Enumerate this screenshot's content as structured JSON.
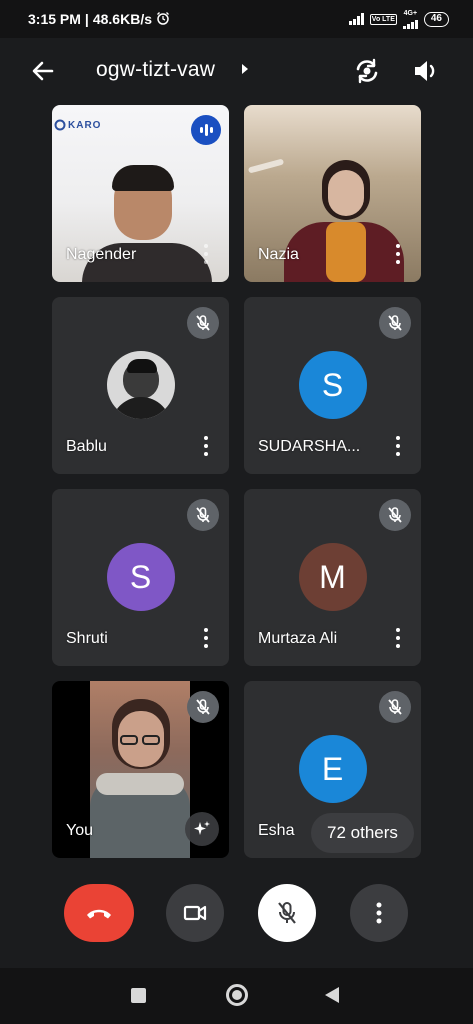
{
  "status_bar": {
    "time": "3:15 PM",
    "speed": "48.6KB/s",
    "network_label": "4G+",
    "volte_label": "Vo LTE",
    "battery": "46"
  },
  "header": {
    "meeting_code": "ogw-tizt-vaw",
    "icons": [
      "back-arrow-icon",
      "caret-right-icon",
      "switch-camera-icon",
      "speaker-icon"
    ]
  },
  "participants": [
    {
      "name": "Nagender",
      "type": "video",
      "logo_text": "KARO",
      "muted": false
    },
    {
      "name": "Nazia",
      "type": "video",
      "muted": false
    },
    {
      "name": "Bablu",
      "type": "photo-avatar",
      "muted": true
    },
    {
      "name": "SUDARSHA...",
      "type": "letter-avatar",
      "initial": "S",
      "color": "#1a87d8",
      "muted": true
    },
    {
      "name": "Shruti",
      "type": "letter-avatar",
      "initial": "S",
      "color": "#7f57c6",
      "muted": true
    },
    {
      "name": "Murtaza Ali",
      "type": "letter-avatar",
      "initial": "M",
      "color": "#6d3f34",
      "muted": true
    },
    {
      "name": "You",
      "type": "video",
      "muted": true
    },
    {
      "name": "Esha",
      "type": "letter-avatar",
      "initial": "E",
      "color": "#1a87d8",
      "muted": true
    }
  ],
  "others_count_label": "72 others",
  "controls": {
    "end_call_color": "#ea4335",
    "items": [
      "end-call",
      "camera",
      "microphone-muted",
      "more-options"
    ]
  },
  "colors": {
    "background": "#1b1c1e",
    "tile": "#2e2f31",
    "control_dark": "#3c3d40"
  }
}
